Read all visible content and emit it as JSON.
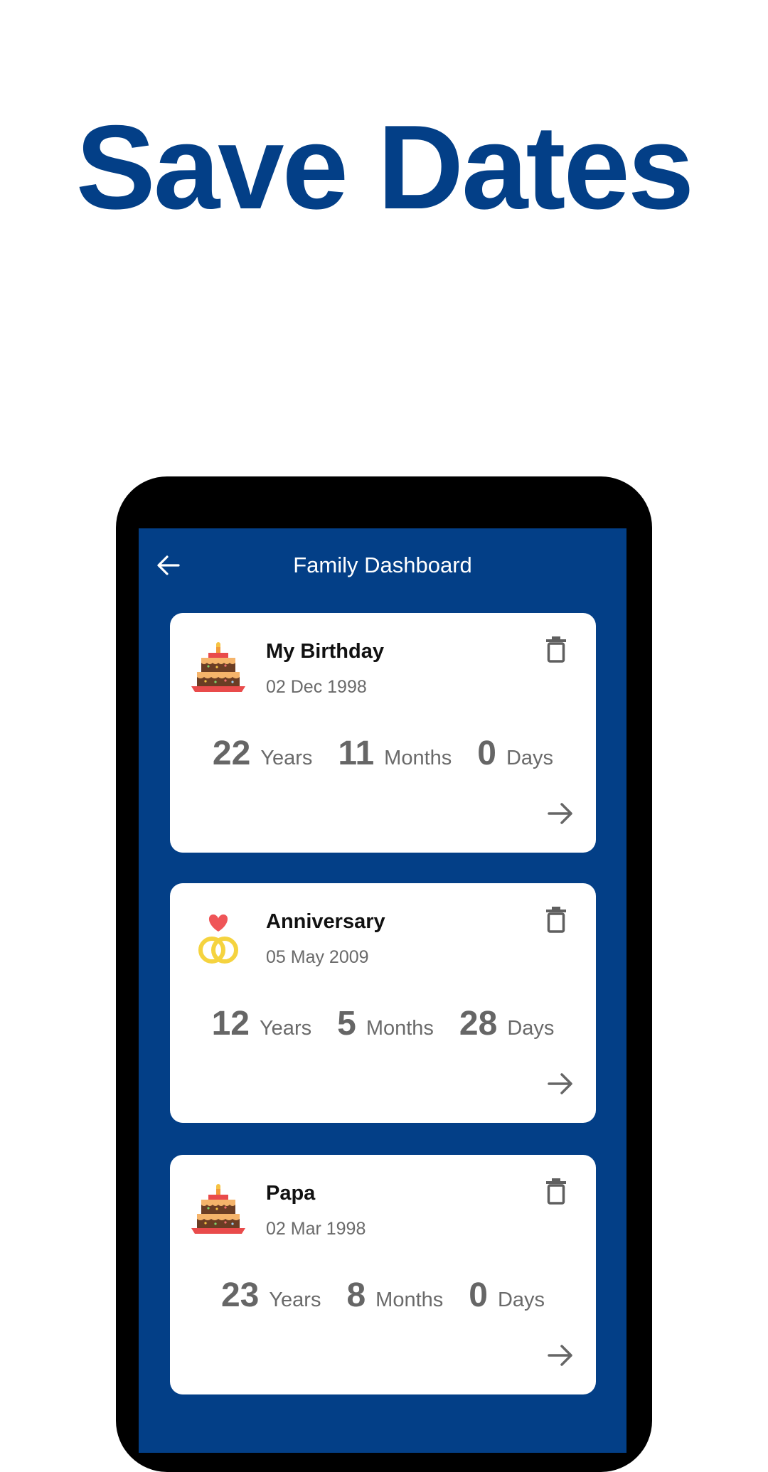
{
  "headline": "Save Dates",
  "app": {
    "title": "Family Dashboard",
    "back_icon": "arrow-left-icon",
    "colors": {
      "primary": "#033f87",
      "card": "#ffffff",
      "text_dark": "#111111",
      "text_muted": "#6a6a6a",
      "frame": "#000000"
    }
  },
  "cards": [
    {
      "title": "My Birthday",
      "date": "02 Dec 1998",
      "icon": "birthday-cake-icon",
      "years": "22",
      "years_label": "Years",
      "months": "11",
      "months_label": "Months",
      "days": "0",
      "days_label": "Days",
      "delete_icon": "trash-icon",
      "open_icon": "arrow-right-icon"
    },
    {
      "title": "Anniversary",
      "date": "05 May 2009",
      "icon": "wedding-rings-icon",
      "years": "12",
      "years_label": "Years",
      "months": "5",
      "months_label": "Months",
      "days": "28",
      "days_label": "Days",
      "delete_icon": "trash-icon",
      "open_icon": "arrow-right-icon"
    },
    {
      "title": "Papa",
      "date": "02 Mar 1998",
      "icon": "birthday-cake-icon",
      "years": "23",
      "years_label": "Years",
      "months": "8",
      "months_label": "Months",
      "days": "0",
      "days_label": "Days",
      "delete_icon": "trash-icon",
      "open_icon": "arrow-right-icon"
    }
  ]
}
